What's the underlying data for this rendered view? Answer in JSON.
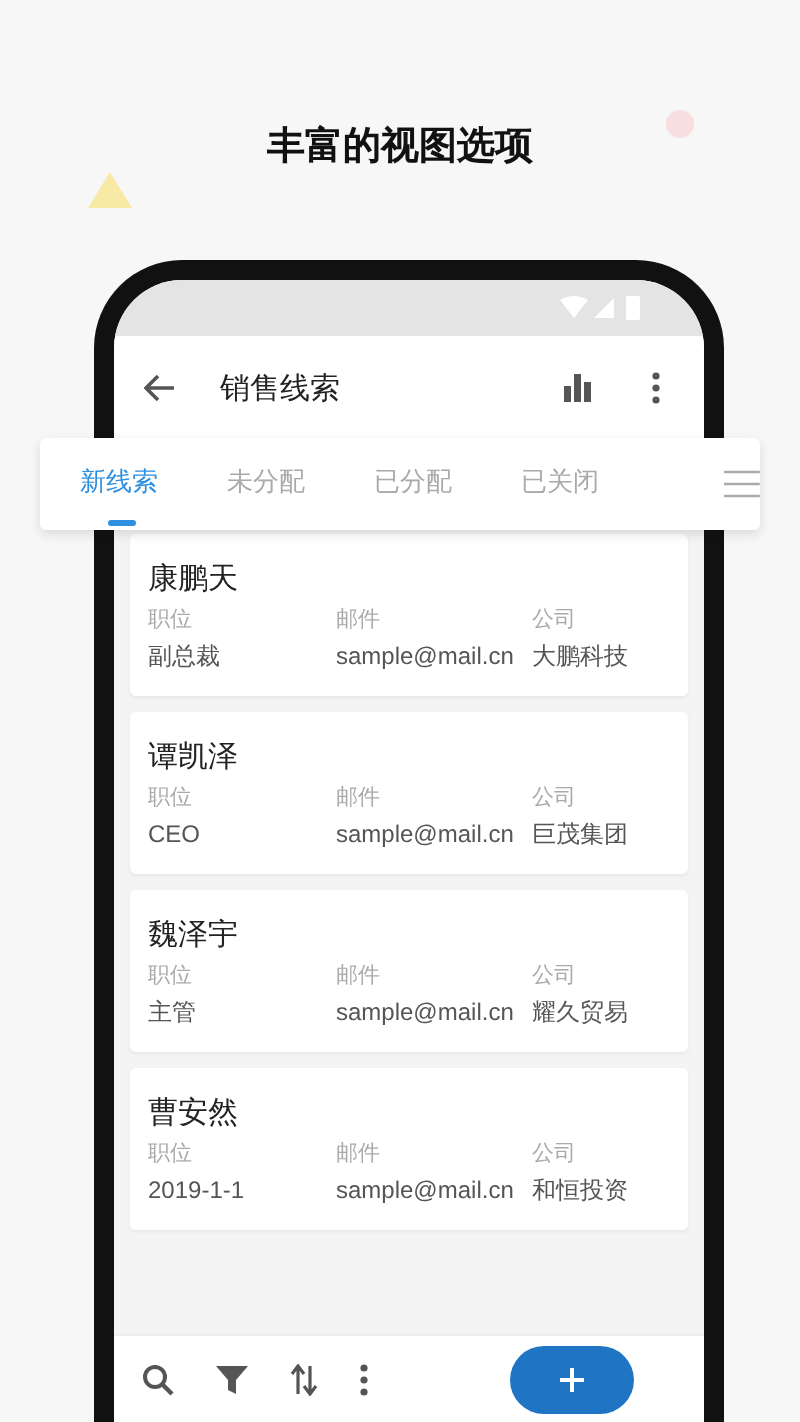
{
  "heading": "丰富的视图选项",
  "app_bar": {
    "title": "销售线索"
  },
  "tabs": [
    {
      "label": "新线索",
      "selected": true
    },
    {
      "label": "未分配",
      "selected": false
    },
    {
      "label": "已分配",
      "selected": false
    },
    {
      "label": "已关闭",
      "selected": false
    }
  ],
  "leads": [
    {
      "name": "康鹏天",
      "fields": [
        {
          "label": "职位",
          "value": "副总裁"
        },
        {
          "label": "邮件",
          "value": "sample@mail.cn"
        },
        {
          "label": "公司",
          "value": "大鹏科技"
        }
      ]
    },
    {
      "name": "谭凯泽",
      "fields": [
        {
          "label": "职位",
          "value": "CEO"
        },
        {
          "label": "邮件",
          "value": "sample@mail.cn"
        },
        {
          "label": "公司",
          "value": "巨茂集团"
        }
      ]
    },
    {
      "name": "魏泽宇",
      "fields": [
        {
          "label": "职位",
          "value": "主管"
        },
        {
          "label": "邮件",
          "value": "sample@mail.cn"
        },
        {
          "label": "公司",
          "value": "耀久贸易"
        }
      ]
    },
    {
      "name": "曹安然",
      "fields": [
        {
          "label": "职位",
          "value": "2019-1-1"
        },
        {
          "label": "邮件",
          "value": "sample@mail.cn"
        },
        {
          "label": "公司",
          "value": "和恒投资"
        }
      ]
    }
  ]
}
